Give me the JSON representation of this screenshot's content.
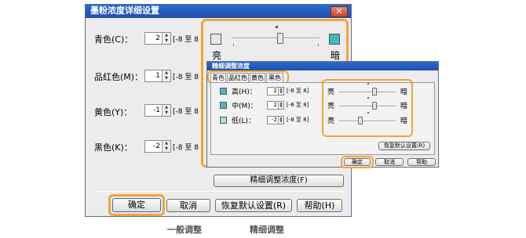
{
  "main_dialog": {
    "title": "墨粉浓度详细设置",
    "close_glyph": "✕",
    "colors": [
      {
        "label": "青色(C)：",
        "value": "2",
        "range": "[-8 至 8"
      },
      {
        "label": "品红色(M)：",
        "value": "1",
        "range": "[-8 至 8"
      },
      {
        "label": "黄色(Y)：",
        "value": "-1",
        "range": "[-8 至 8"
      },
      {
        "label": "黑色(K)：",
        "value": "-2",
        "range": "[-8 至 8"
      }
    ],
    "fine_adjust_button": "精细调整浓度(F)",
    "buttons": {
      "ok": "确定",
      "cancel": "取消",
      "restore": "恢复默认设置(R)",
      "help": "帮助(H)"
    }
  },
  "overlay_slider": {
    "light_label": "亮",
    "dark_label": "暗",
    "swatch_color": "#3fb8c4",
    "level": 0.55
  },
  "fine_dialog": {
    "title": "精细调整浓度",
    "tabs": [
      "青色",
      "品红色",
      "黄色",
      "黑色"
    ],
    "rows": [
      {
        "label": "高(H)：",
        "value": "2",
        "range": "[-8 至 8]",
        "swatch": "#4ab8c4",
        "level": 0.62
      },
      {
        "label": "中(M)：",
        "value": "2",
        "range": "[-8 至 8]",
        "swatch": "#4ab8c4",
        "level": 0.62
      },
      {
        "label": "低(L)：",
        "value": "-2",
        "range": "[-8 至 8]",
        "swatch": "#a9dde3",
        "level": 0.38
      }
    ],
    "light_label": "亮",
    "dark_label": "暗",
    "restore_button": "恢复默认设置(R)",
    "buttons": {
      "ok": "确定",
      "cancel": "取消",
      "help": "帮助"
    }
  },
  "captions": {
    "general": "一般调整",
    "fine": "精细调整"
  },
  "accent": "#f2a533"
}
